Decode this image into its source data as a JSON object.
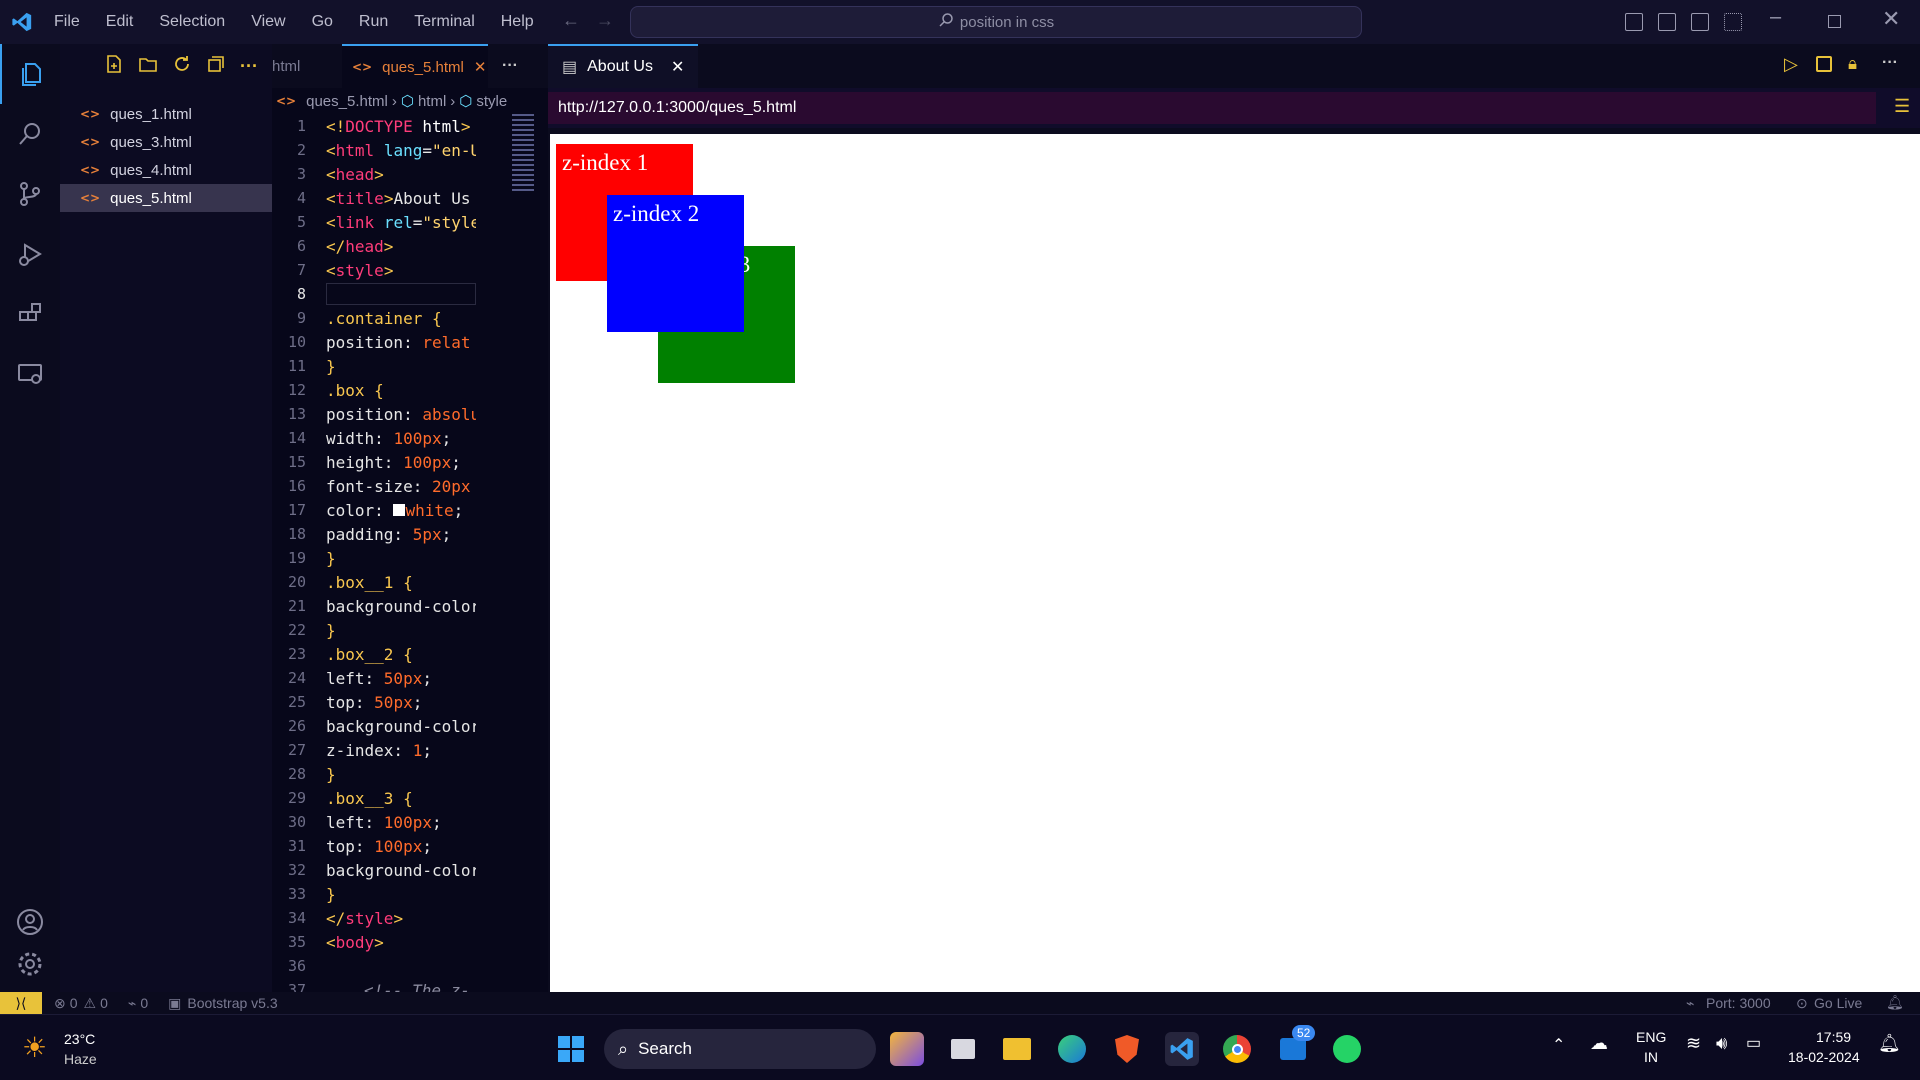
{
  "menu": [
    "File",
    "Edit",
    "Selection",
    "View",
    "Go",
    "Run",
    "Terminal",
    "Help"
  ],
  "search": {
    "text": "position in css"
  },
  "files": [
    "ques_1.html",
    "ques_3.html",
    "ques_4.html",
    "ques_5.html"
  ],
  "editor_tabs": {
    "prev": "html",
    "active": "ques_5.html"
  },
  "breadcrumb": {
    "file": "ques_5.html",
    "html": "html",
    "style": "style"
  },
  "code": [
    {
      "n": "1",
      "t": "<!DOCTYPE html>"
    },
    {
      "n": "2",
      "t": "<html lang=\"en-U"
    },
    {
      "n": "3",
      "t": "<head>"
    },
    {
      "n": "4",
      "t": "<title>About Us"
    },
    {
      "n": "5",
      "t": "<link rel=\"style"
    },
    {
      "n": "6",
      "t": "</head>"
    },
    {
      "n": "7",
      "t": "<style>"
    },
    {
      "n": "8",
      "t": ""
    },
    {
      "n": "9",
      "t": ".container {"
    },
    {
      "n": "10",
      "t": "position: relat"
    },
    {
      "n": "11",
      "t": "}"
    },
    {
      "n": "12",
      "t": ".box {"
    },
    {
      "n": "13",
      "t": "position: absolu"
    },
    {
      "n": "14",
      "t": "width: 100px;"
    },
    {
      "n": "15",
      "t": "height: 100px;"
    },
    {
      "n": "16",
      "t": "font-size: 20px"
    },
    {
      "n": "17",
      "t": "color: white;"
    },
    {
      "n": "18",
      "t": "padding: 5px;"
    },
    {
      "n": "19",
      "t": "}"
    },
    {
      "n": "20",
      "t": ".box__1 {"
    },
    {
      "n": "21",
      "t": "background-color"
    },
    {
      "n": "22",
      "t": "}"
    },
    {
      "n": "23",
      "t": ".box__2 {"
    },
    {
      "n": "24",
      "t": "left: 50px;"
    },
    {
      "n": "25",
      "t": "top: 50px;"
    },
    {
      "n": "26",
      "t": "background-color"
    },
    {
      "n": "27",
      "t": "z-index: 1;"
    },
    {
      "n": "28",
      "t": "}"
    },
    {
      "n": "29",
      "t": ".box__3 {"
    },
    {
      "n": "30",
      "t": "left: 100px;"
    },
    {
      "n": "31",
      "t": "top: 100px;"
    },
    {
      "n": "32",
      "t": "background-color"
    },
    {
      "n": "33",
      "t": "}"
    },
    {
      "n": "34",
      "t": "</style>"
    },
    {
      "n": "35",
      "t": "<body>"
    },
    {
      "n": "36",
      "t": ""
    },
    {
      "n": "37",
      "t": "<!-- The z-"
    }
  ],
  "preview": {
    "tab": "About Us",
    "url": "http://127.0.0.1:3000/ques_5.html",
    "boxes": [
      {
        "label": "z-index 1",
        "color": "#ff0000"
      },
      {
        "label": "z-index 2",
        "color": "#0000ff"
      },
      {
        "label": "z-index 3",
        "color": "#008000"
      }
    ]
  },
  "status": {
    "errors": "0",
    "warnings": "0",
    "ports": "0",
    "bootstrap": "Bootstrap v5.3",
    "port": "Port: 3000",
    "golive": "Go Live"
  },
  "taskbar": {
    "temp": "23°C",
    "weather": "Haze",
    "search": "Search",
    "badge": "52",
    "lang1": "ENG",
    "lang2": "IN",
    "time": "17:59",
    "date": "18-02-2024"
  }
}
